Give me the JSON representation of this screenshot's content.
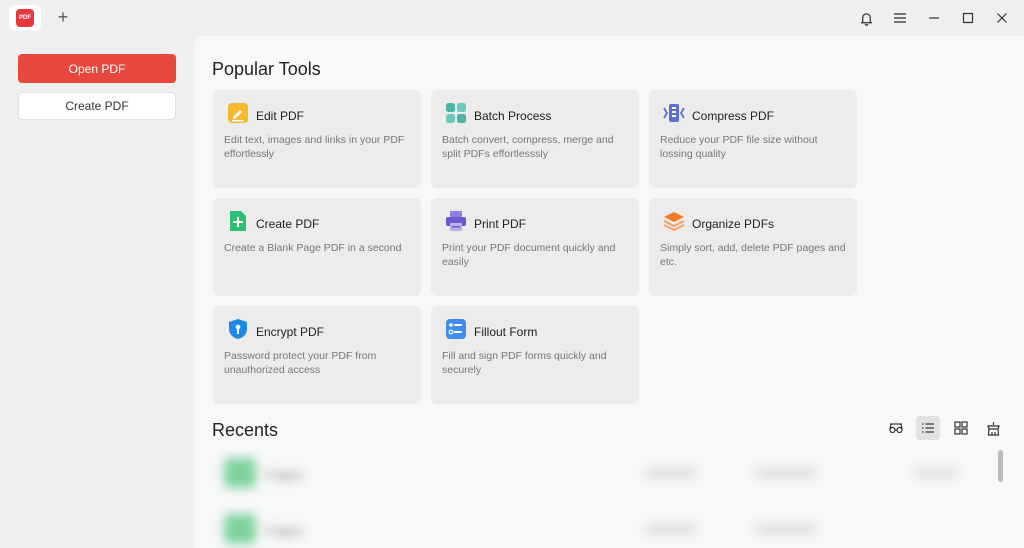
{
  "titlebar": {
    "app_logo_text": "PDF",
    "new_tab_icon": "plus-icon",
    "icons": [
      "bell-icon",
      "menu-icon",
      "minimize-icon",
      "maximize-icon",
      "close-icon"
    ]
  },
  "sidebar": {
    "open_label": "Open PDF",
    "create_label": "Create PDF"
  },
  "main": {
    "tools_title": "Popular Tools",
    "recents_title": "Recents",
    "tools": [
      {
        "name": "Edit PDF",
        "desc": "Edit text, images and links in your PDF effortlessly",
        "icon": "edit-pdf-icon",
        "color": "#f5b82e"
      },
      {
        "name": "Batch Process",
        "desc": "Batch convert, compress, merge and split PDFs effortlesssly",
        "icon": "batch-process-icon",
        "color": "#4bb5a8"
      },
      {
        "name": "Compress PDF",
        "desc": "Reduce your PDF file size without lossing quality",
        "icon": "compress-pdf-icon",
        "color": "#5b6fd6"
      },
      {
        "name": "Create PDF",
        "desc": "Create a Blank Page PDF in a second",
        "icon": "create-pdf-icon",
        "color": "#2fbf71"
      },
      {
        "name": "Print PDF",
        "desc": "Print your PDF document quickly and easily",
        "icon": "printer-icon",
        "color": "#6a5acd"
      },
      {
        "name": "Organize PDFs",
        "desc": "Simply sort, add, delete PDF pages and etc.",
        "icon": "organize-pdfs-icon",
        "color": "#f07a2a"
      },
      {
        "name": "Encrypt PDF",
        "desc": "Password protect your PDF from unauthorized access",
        "icon": "shield-icon",
        "color": "#1e88e5"
      },
      {
        "name": "Fillout Form",
        "desc": "Fill and sign PDF forms quickly and securely",
        "icon": "form-icon",
        "color": "#3f8ef0"
      }
    ],
    "view_icons": [
      "glasses-icon",
      "list-view-icon",
      "grid-view-icon",
      "clean-icon"
    ],
    "recents": [
      {
        "name": "Folgen"
      },
      {
        "name": "Folgen"
      }
    ]
  },
  "colors": {
    "accent": "#e8473e",
    "sidebar_bg": "#efefef",
    "card_bg": "#ececec"
  }
}
